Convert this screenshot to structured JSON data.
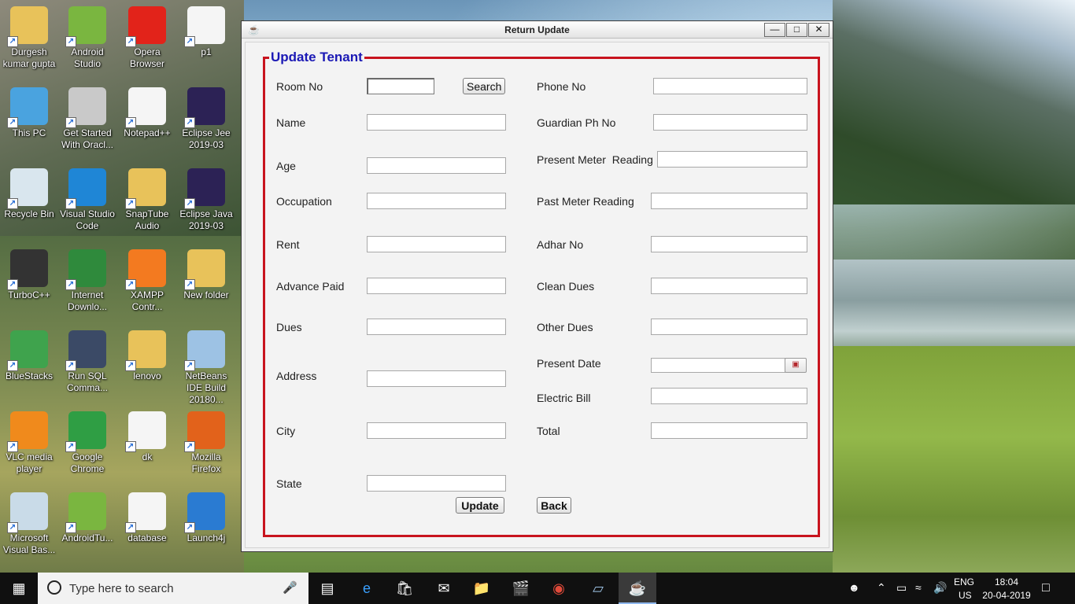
{
  "desktop": {
    "icons": [
      {
        "label": "Durgesh kumar gupta",
        "glyph": "user-folder-icon",
        "color": "#e8c25a"
      },
      {
        "label": "Android Studio",
        "glyph": "android-studio-icon",
        "color": "#7ab640"
      },
      {
        "label": "Opera Browser",
        "glyph": "opera-icon",
        "color": "#e2231a"
      },
      {
        "label": "p1",
        "glyph": "file-icon",
        "color": "#f5f5f5"
      },
      {
        "label": "This PC",
        "glyph": "computer-icon",
        "color": "#4aa3df"
      },
      {
        "label": "Get Started With Oracl...",
        "glyph": "database-icon",
        "color": "#c9c9c9"
      },
      {
        "label": "Notepad++",
        "glyph": "file-icon",
        "color": "#f5f5f5"
      },
      {
        "label": "Eclipse Jee 2019-03",
        "glyph": "eclipse-icon",
        "color": "#2c2255"
      },
      {
        "label": "Recycle Bin",
        "glyph": "recycle-bin-icon",
        "color": "#d9e6ee"
      },
      {
        "label": "Visual Studio Code",
        "glyph": "vscode-icon",
        "color": "#1f86d6"
      },
      {
        "label": "SnapTube Audio",
        "glyph": "folder-icon",
        "color": "#e8c25a"
      },
      {
        "label": "Eclipse Java 2019-03",
        "glyph": "eclipse-icon",
        "color": "#2c2255"
      },
      {
        "label": "TurboC++",
        "glyph": "turboc-icon",
        "color": "#333333"
      },
      {
        "label": "Internet Downlo...",
        "glyph": "idm-icon",
        "color": "#2f8a3c"
      },
      {
        "label": "XAMPP Contr...",
        "glyph": "xampp-icon",
        "color": "#f37a20"
      },
      {
        "label": "New folder",
        "glyph": "folder-icon",
        "color": "#e8c25a"
      },
      {
        "label": "BlueStacks",
        "glyph": "bluestacks-icon",
        "color": "#3fa34d"
      },
      {
        "label": "Run SQL Comma...",
        "glyph": "sql-icon",
        "color": "#3b4a66"
      },
      {
        "label": "lenovo",
        "glyph": "folder-icon",
        "color": "#e8c25a"
      },
      {
        "label": "NetBeans IDE Build 20180...",
        "glyph": "netbeans-icon",
        "color": "#9dc2e4"
      },
      {
        "label": "VLC media player",
        "glyph": "vlc-icon",
        "color": "#f08a1c"
      },
      {
        "label": "Google Chrome",
        "glyph": "chrome-icon",
        "color": "#2f9e44"
      },
      {
        "label": "dk",
        "glyph": "file-icon",
        "color": "#f5f5f5"
      },
      {
        "label": "Mozilla Firefox",
        "glyph": "firefox-icon",
        "color": "#e2621b"
      },
      {
        "label": "Microsoft Visual Bas...",
        "glyph": "vb-icon",
        "color": "#c9dbe8"
      },
      {
        "label": "AndroidTu...",
        "glyph": "android-studio-icon",
        "color": "#7ab640"
      },
      {
        "label": "database",
        "glyph": "file-icon",
        "color": "#f5f5f5"
      },
      {
        "label": "Launch4j",
        "glyph": "launch4j-icon",
        "color": "#2a7bd2"
      }
    ]
  },
  "window": {
    "title": "Return Update",
    "minimize": "—",
    "maximize": "□",
    "close": "✕",
    "panel_title": "Update Tenant",
    "left_fields": [
      {
        "label": "Room No",
        "value": ""
      },
      {
        "label": "Name",
        "value": ""
      },
      {
        "label": "Age",
        "value": ""
      },
      {
        "label": "Occupation",
        "value": ""
      },
      {
        "label": "Rent",
        "value": ""
      },
      {
        "label": "Advance Paid",
        "value": ""
      },
      {
        "label": "Dues",
        "value": ""
      },
      {
        "label": "Address",
        "value": ""
      },
      {
        "label": "City",
        "value": ""
      },
      {
        "label": "State",
        "value": ""
      }
    ],
    "right_fields": [
      {
        "label": "Phone No",
        "value": ""
      },
      {
        "label": "Guardian Ph No",
        "value": ""
      },
      {
        "label": "Present Meter  Reading",
        "value": ""
      },
      {
        "label": "Past Meter Reading",
        "value": ""
      },
      {
        "label": "Adhar No",
        "value": ""
      },
      {
        "label": "Clean Dues",
        "value": ""
      },
      {
        "label": "Other Dues",
        "value": ""
      },
      {
        "label": "Present Date",
        "value": ""
      },
      {
        "label": "Electric Bill",
        "value": ""
      },
      {
        "label": "Total",
        "value": ""
      }
    ],
    "search_label": "Search",
    "update_label": "Update",
    "back_label": "Back"
  },
  "taskbar": {
    "search_placeholder": "Type here to search",
    "apps": [
      "task-view-icon",
      "edge-icon",
      "store-icon",
      "mail-icon",
      "file-explorer-icon",
      "movies-icon",
      "chrome-icon",
      "netbeans-icon",
      "java-icon"
    ],
    "lang": "ENG",
    "region": "US",
    "time": "18:04",
    "date": "20-04-2019"
  }
}
